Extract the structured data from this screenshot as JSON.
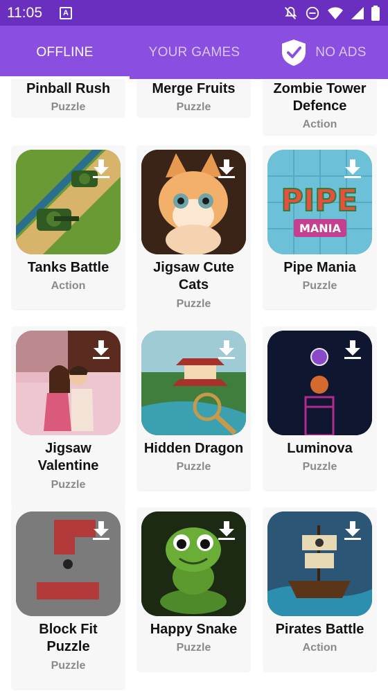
{
  "statusbar": {
    "time": "11:05",
    "badge": "A"
  },
  "tabs": {
    "offline": "OFFLINE",
    "your_games": "YOUR GAMES",
    "no_ads": "NO ADS"
  },
  "games_top": [
    {
      "title": "Pinball Rush",
      "category": "Puzzle"
    },
    {
      "title": "Merge Fruits",
      "category": "Puzzle"
    },
    {
      "title1": "Zombie Tower",
      "title2": "Defence",
      "category": "Action"
    }
  ],
  "games": [
    {
      "title1": "Tanks Battle",
      "category": "Action",
      "icon": "tank-icon"
    },
    {
      "title1": "Jigsaw Cute",
      "title2": "Cats",
      "category": "Puzzle",
      "icon": "cat-icon"
    },
    {
      "title1": "Pipe Mania",
      "category": "Puzzle",
      "icon": "pipe-icon",
      "logo1": "PIPE",
      "logo2": "MANIA"
    },
    {
      "title1": "Jigsaw",
      "title2": "Valentine",
      "category": "Puzzle",
      "icon": "couple-icon"
    },
    {
      "title1": "Hidden Dragon",
      "category": "Puzzle",
      "icon": "pagoda-icon"
    },
    {
      "title1": "Luminova",
      "category": "Puzzle",
      "icon": "glow-icon"
    },
    {
      "title1": "Block Fit",
      "title2": "Puzzle",
      "category": "Puzzle",
      "icon": "blocks-icon"
    },
    {
      "title1": "Happy Snake",
      "category": "Puzzle",
      "icon": "snake-icon"
    },
    {
      "title1": "Pirates Battle",
      "category": "Action",
      "icon": "ship-icon"
    }
  ],
  "colors": {
    "statusbar": "#6a2fbf",
    "tabbar": "#8a4fe0",
    "accent": "#ffffff"
  }
}
